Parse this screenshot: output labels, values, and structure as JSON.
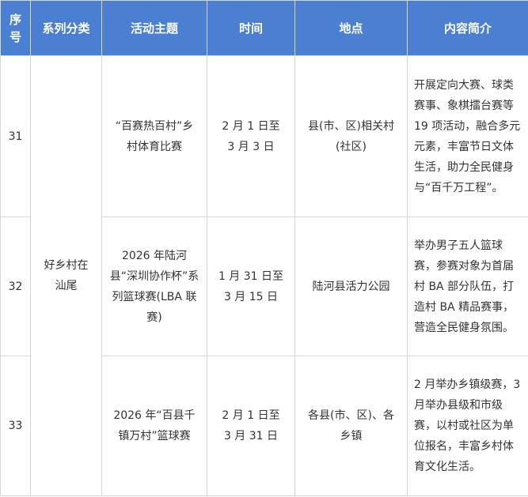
{
  "table": {
    "headers": [
      "序号",
      "系列分类",
      "活动主题",
      "时间",
      "地点",
      "内容简介"
    ],
    "category": "好乡村在汕尾",
    "rows": [
      {
        "no": "31",
        "theme": "“百赛热百村”乡村体育比赛",
        "time": "2 月 1 日至 3 月 3 日",
        "place": "县(市、区)相关村(社区)",
        "desc": "开展定向大赛、球类赛事、象棋擂台赛等 19 项活动，融合多元元素，丰富节日文体生活，助力全民健身与“百千万工程”。"
      },
      {
        "no": "32",
        "theme": "2026 年陆河县“深圳协作杯”系列篮球赛(LBA 联赛)",
        "time": "1 月 31 日至 3 月 15 日",
        "place": "陆河县活力公园",
        "desc": "举办男子五人篮球赛，参赛对象为首届村 BA 部分队伍，打造村 BA 精品赛事，营造全民健身氛围。"
      },
      {
        "no": "33",
        "theme": "2026 年“百县千镇万村”篮球赛",
        "time": "2 月 1 日至 3 月 31 日",
        "place": "各县(市、区)、各乡镇",
        "desc": "2 月举办乡镇级赛，3 月举办县级和市级赛，以村或社区为单位报名，丰富乡村体育文化生活。"
      }
    ]
  }
}
